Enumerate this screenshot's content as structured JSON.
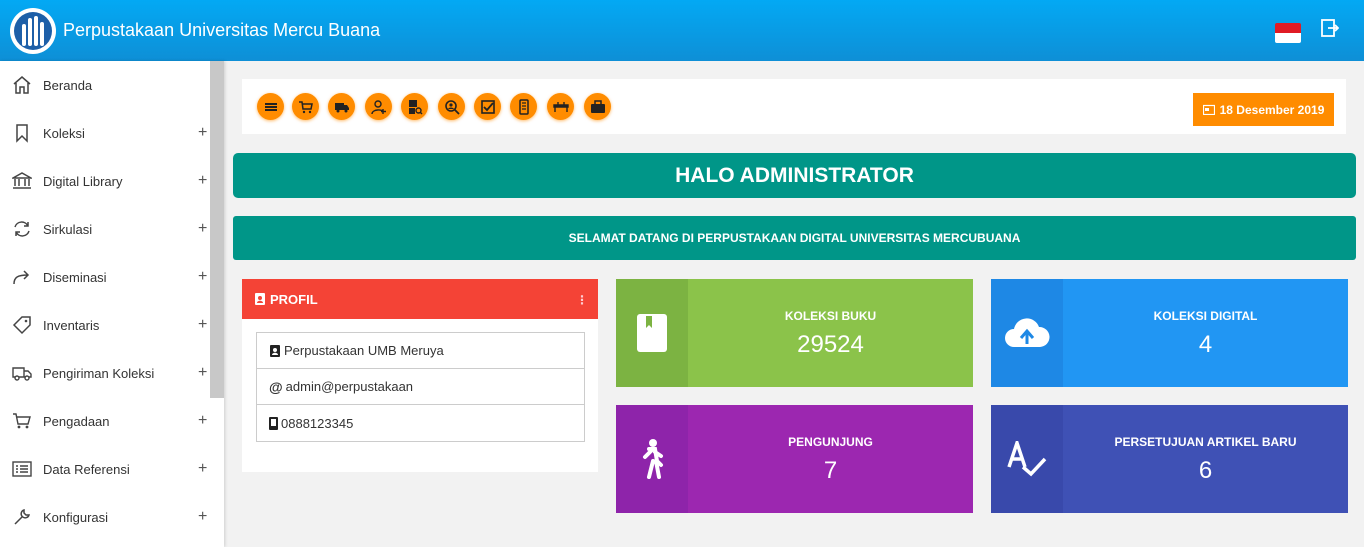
{
  "app": {
    "title": "Perpustakaan Universitas Mercu Buana"
  },
  "sidebar": {
    "items": [
      {
        "label": "Beranda",
        "icon": "home-icon",
        "expandable": false
      },
      {
        "label": "Koleksi",
        "icon": "bookmark-icon",
        "expandable": true
      },
      {
        "label": "Digital Library",
        "icon": "bank-icon",
        "expandable": true
      },
      {
        "label": "Sirkulasi",
        "icon": "refresh-icon",
        "expandable": true
      },
      {
        "label": "Diseminasi",
        "icon": "share-icon",
        "expandable": true
      },
      {
        "label": "Inventaris",
        "icon": "tag-icon",
        "expandable": true
      },
      {
        "label": "Pengiriman Koleksi",
        "icon": "truck-icon",
        "expandable": true
      },
      {
        "label": "Pengadaan",
        "icon": "cart-icon",
        "expandable": true
      },
      {
        "label": "Data Referensi",
        "icon": "list-icon",
        "expandable": true
      },
      {
        "label": "Konfigurasi",
        "icon": "wrench-icon",
        "expandable": true
      }
    ],
    "plus": "+"
  },
  "toolbar": {
    "shortcuts": [
      "books-icon",
      "cart-icon",
      "truck-icon",
      "user-add-icon",
      "document-search-icon",
      "user-search-icon",
      "checkbox-icon",
      "phone-icon",
      "table-icon",
      "briefcase-icon"
    ],
    "date": "18 Desember 2019"
  },
  "banner": {
    "greeting": "HALO ADMINISTRATOR",
    "welcome": "SELAMAT DATANG DI PERPUSTAKAAN DIGITAL UNIVERSITAS MERCUBUANA"
  },
  "profile": {
    "title": "PROFIL",
    "name": "Perpustakaan UMB Meruya",
    "email": "admin@perpustakaan",
    "phone": "0888123345"
  },
  "stats": [
    {
      "title": "KOLEKSI BUKU",
      "value": "29524",
      "color": "#8bc34a",
      "icon_bg": "#7cb342",
      "icon": "book-icon"
    },
    {
      "title": "KOLEKSI DIGITAL",
      "value": "4",
      "color": "#2196f3",
      "icon_bg": "#1e88e5",
      "icon": "cloud-upload-icon"
    },
    {
      "title": "PENGUNJUNG",
      "value": "7",
      "color": "#9c27b0",
      "icon_bg": "#8e24aa",
      "icon": "walk-icon"
    },
    {
      "title": "PERSETUJUAN ARTIKEL BARU",
      "value": "6",
      "color": "#3f51b5",
      "icon_bg": "#3949ab",
      "icon": "spellcheck-icon"
    }
  ],
  "colors": {
    "header": "#039be5",
    "accent": "#ff8c00",
    "teal": "#009688",
    "profile_head": "#f44336"
  }
}
